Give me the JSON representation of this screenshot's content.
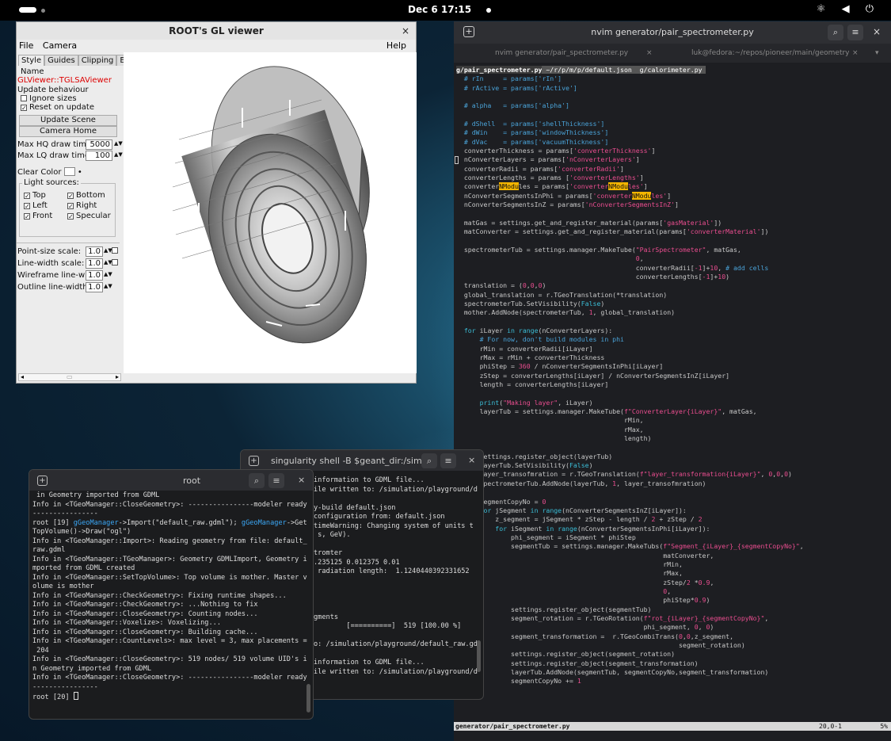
{
  "topbar": {
    "clock": "Dec 6 17:15",
    "tray": "⚛ ◀ ⏻"
  },
  "root_viewer": {
    "title": "ROOT's GL viewer",
    "close": "×",
    "menu": {
      "file": "File",
      "camera": "Camera",
      "help": "Help"
    },
    "tabs": [
      "Style",
      "Guides",
      "Clipping",
      "Extras"
    ],
    "name_label": "Name",
    "viewer_name": "GLViewer::TGLSAViewer",
    "update_behaviour": "Update behaviour",
    "ignore_sizes": "Ignore sizes",
    "reset_on_update": "Reset on update",
    "update_scene": "Update Scene",
    "camera_home": "Camera Home",
    "max_hq_label": "Max HQ draw time:",
    "max_hq_value": "5000",
    "max_lq_label": "Max LQ draw time:",
    "max_lq_value": "100",
    "clear_color": "Clear Color",
    "light_sources": "Light sources:",
    "lights": {
      "top": "Top",
      "bottom": "Bottom",
      "left": "Left",
      "right": "Right",
      "front": "Front",
      "specular": "Specular"
    },
    "point_size_label": "Point-size scale:",
    "point_size_value": "1.0",
    "line_width_label": "Line-width scale:",
    "line_width_value": "1.0",
    "wireframe_label": "Wireframe line-width:",
    "wireframe_value": "1.0",
    "outline_label": "Outline line-width:",
    "outline_value": "1.0"
  },
  "nvim": {
    "title": "nvim generator/pair_spectrometer.py",
    "tabs": [
      "nvim generator/pair_spectrometer.py",
      "luk@fedora:~/repos/pioneer/main/geometry"
    ],
    "pathbar": {
      "file": "g/pair_spectrometer.py",
      "rest": " ~/r/p/m/p/default.json  g/calorimeter.py "
    },
    "status_file": "generator/pair_spectrometer.py",
    "status_pos": "20,0-1",
    "status_pct": "5%"
  },
  "terminal_root": {
    "title": "root",
    "lines": [
      " in Geometry imported from GDML",
      "Info in <TGeoManager::CloseGeometry>: ----------------modeler ready",
      "----------------",
      "root [19] gGeoManager->Import(\"default_raw.gdml\"); gGeoManager->Get",
      "TopVolume()->Draw(\"ogl\")",
      "Info in <TGeoManager::Import>: Reading geometry from file: default_",
      "raw.gdml",
      "Info in <TGeoManager::TGeoManager>: Geometry GDMLImport, Geometry i",
      "mported from GDML created",
      "Info in <TGeoManager::SetTopVolume>: Top volume is mother. Master v",
      "olume is mother",
      "Info in <TGeoManager::CheckGeometry>: Fixing runtime shapes...",
      "Info in <TGeoManager::CheckGeometry>: ...Nothing to fix",
      "Info in <TGeoManager::CloseGeometry>: Counting nodes...",
      "Info in <TGeoManager::Voxelize>: Voxelizing...",
      "Info in <TGeoManager::CloseGeometry>: Building cache...",
      "Info in <TGeoManager::CountLevels>: max level = 3, max placements =",
      " 204",
      "Info in <TGeoManager::CloseGeometry>: 519 nodes/ 519 volume UID's i",
      "n Geometry imported from GDML",
      "Info in <TGeoManager::CloseGeometry>: ----------------modeler ready",
      "----------------",
      "root [20] "
    ]
  },
  "terminal_singularity": {
    "title": "singularity shell -B $geant_dir:/simu...",
    "lines": [
      "information to GDML file...",
      "ile written to: /simulation/playground/d",
      "",
      "y-build default.json",
      "configuration from: default.json",
      "timeWarning: Changing system of units t",
      " s, GeV).",
      "",
      "tromter",
      ".235125 0.012375 0.01",
      " radiation length:  1.1240440392331652",
      "",
      "",
      "",
      "",
      "gments",
      "        [==========]  519 [100.00 %]",
      "",
      "o: /simulation/playground/default_raw.gd",
      "",
      "information to GDML file...",
      "ile written to: /simulation/playground/d"
    ]
  }
}
